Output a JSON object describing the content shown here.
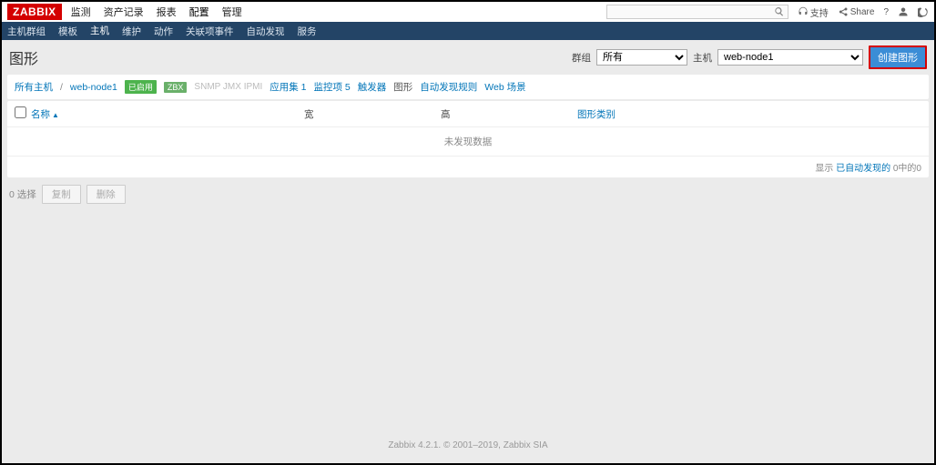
{
  "logo": "ZABBIX",
  "zabbix_small": "zabbix",
  "topnav": {
    "items": [
      "监测",
      "资产记录",
      "报表",
      "配置",
      "管理"
    ],
    "active_index": 3
  },
  "top_right": {
    "support": "支持",
    "share": "Share"
  },
  "subnav": {
    "items": [
      "主机群组",
      "模板",
      "主机",
      "维护",
      "动作",
      "关联项事件",
      "自动发现",
      "服务"
    ],
    "active_index": 2
  },
  "page_title": "图形",
  "filters": {
    "group_label": "群组",
    "group_value": "所有",
    "host_label": "主机",
    "host_value": "web-node1",
    "create_label": "创建图形"
  },
  "host_row": {
    "all_hosts": "所有主机",
    "current": "web-node1",
    "enabled": "已启用",
    "zbx": "ZBX",
    "protos": "SNMP  JMX  IPMI",
    "tabs": [
      {
        "label": "应用集 1"
      },
      {
        "label": "监控项 5"
      },
      {
        "label": "触发器"
      },
      {
        "label": "图形",
        "active": true
      },
      {
        "label": "自动发现规则"
      },
      {
        "label": "Web 场景"
      }
    ]
  },
  "table": {
    "col_name": "名称",
    "col_width": "宽",
    "col_height": "高",
    "col_type": "图形类别",
    "empty": "未发现数据",
    "footer_prefix": "显示 ",
    "footer_link": "已自动发现的",
    "footer_suffix": " 0中的0"
  },
  "below": {
    "selected": "0 选择",
    "copy": "复制",
    "delete": "删除"
  },
  "footer": "Zabbix 4.2.1. © 2001–2019, Zabbix SIA"
}
